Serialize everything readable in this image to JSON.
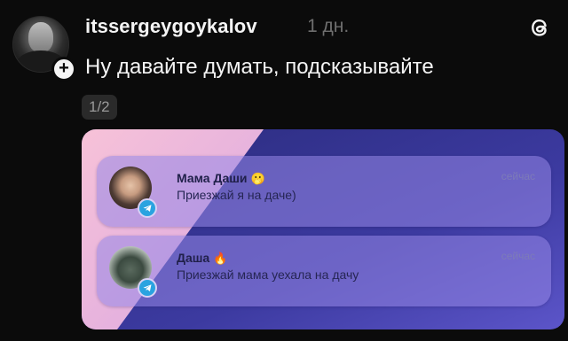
{
  "post": {
    "username": "itssergeygoykalov",
    "time": "1 дн.",
    "text": "Ну давайте думать, подсказывайте",
    "page_counter": "1/2",
    "follow_symbol": "+"
  },
  "image": {
    "notifications": [
      {
        "title": "Мама Даши",
        "emoji": "🫢",
        "message": "Приезжай я на даче)",
        "time": "сейчас",
        "app_icon": "telegram-icon"
      },
      {
        "title": "Даша",
        "emoji": "🔥",
        "message": "Приезжай мама уехала на дачу",
        "time": "сейчас",
        "app_icon": "telegram-icon"
      }
    ]
  },
  "colors": {
    "background": "#0b0b0b",
    "text_primary": "#f4f4f4",
    "text_muted": "#6e6e6e",
    "telegram_blue": "#2aa3e0",
    "card_pink": "#f4b8d6",
    "card_indigo": "#3a3596"
  }
}
